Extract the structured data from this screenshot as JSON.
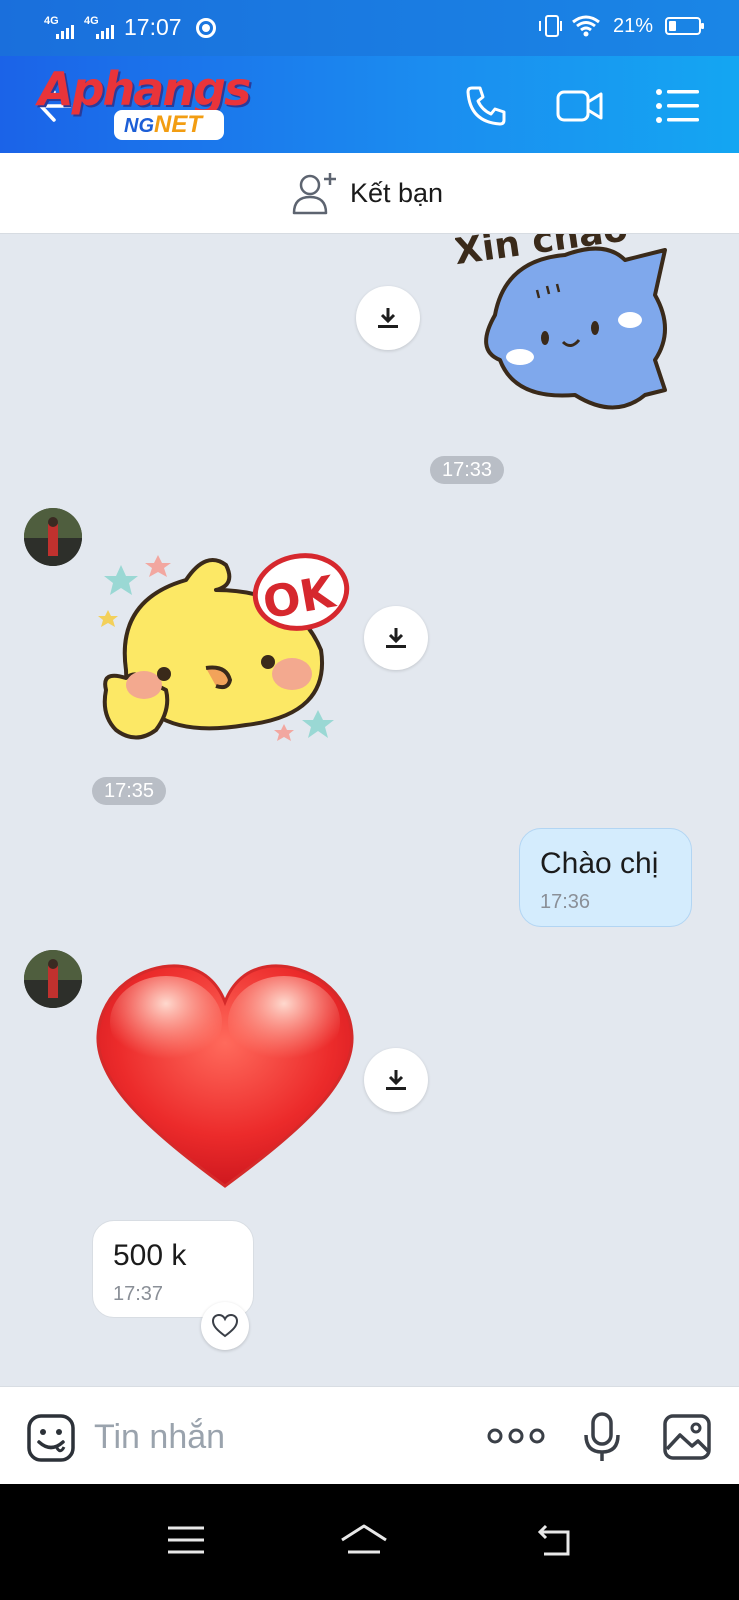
{
  "status_bar": {
    "network_1": "4G",
    "network_2": "4G",
    "time": "17:07",
    "battery_percent": "21%",
    "battery_level": 0.21,
    "icons": [
      "vibrate-icon",
      "wifi-icon",
      "battery-icon",
      "chrome-icon"
    ]
  },
  "header": {
    "logo_main": "Aphangs",
    "logo_sub_prefix": "NG",
    "logo_sub_suffix": "NET",
    "icons": [
      "back-arrow-icon",
      "phone-icon",
      "video-call-icon",
      "list-menu-icon"
    ]
  },
  "add_friend": {
    "label": "Kết bạn",
    "icon": "add-user-icon"
  },
  "messages": [
    {
      "id": "m1",
      "direction": "out",
      "type": "sticker",
      "sticker_text": "Xin chào",
      "sticker": "blue-cat-xin-chao",
      "time": "17:33"
    },
    {
      "id": "m2",
      "direction": "in",
      "type": "sticker",
      "sticker_text": "OK",
      "sticker": "yellow-chick-ok",
      "time": "17:35"
    },
    {
      "id": "m3",
      "direction": "out",
      "type": "text",
      "text": "Chào chị",
      "time": "17:36"
    },
    {
      "id": "m4",
      "direction": "in",
      "type": "sticker",
      "sticker": "red-heart"
    },
    {
      "id": "m5",
      "direction": "in",
      "type": "text",
      "text": "500 k",
      "time": "17:37",
      "reaction_icon": "heart-outline-icon"
    }
  ],
  "input": {
    "placeholder": "Tin nhắn",
    "icons": [
      "emoji-icon",
      "more-dots-icon",
      "microphone-icon",
      "image-icon"
    ]
  },
  "nav_bar": {
    "icons": [
      "menu-lines-icon",
      "home-icon",
      "back-icon"
    ]
  },
  "colors": {
    "header_gradient_start": "#1b63e8",
    "header_gradient_end": "#14a6f2",
    "chat_background": "#e3e8ef",
    "outgoing_bubble": "#d4ecfd",
    "incoming_bubble": "#ffffff",
    "time_pill": "#b9bec6"
  }
}
